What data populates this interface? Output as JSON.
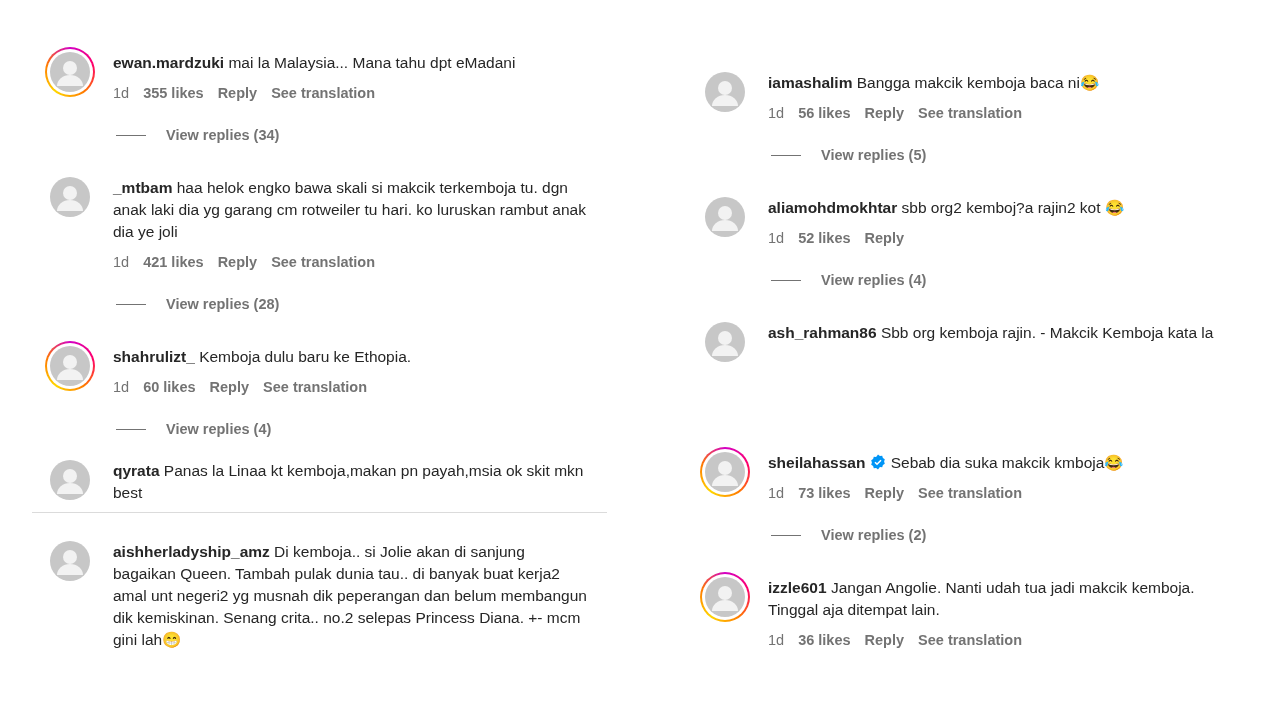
{
  "columns": [
    {
      "sections": [
        {
          "bottom_rule": false,
          "comments": [
            {
              "username": "ewan.mardzuki",
              "verified": false,
              "story_ring": true,
              "text": "mai la Malaysia... Mana tahu dpt eMadani",
              "time": "1d",
              "likes": "355 likes",
              "reply": "Reply",
              "translation": "See translation",
              "view_replies": "View replies (34)"
            },
            {
              "username": "_mtbam",
              "verified": false,
              "story_ring": false,
              "text": "haa helok engko bawa skali si makcik terkemboja tu. dgn anak laki dia yg garang cm rotweiler tu hari. ko luruskan rambut anak dia ye joli",
              "time": "1d",
              "likes": "421 likes",
              "reply": "Reply",
              "translation": "See translation",
              "view_replies": "View replies (28)"
            },
            {
              "username": "shahrulizt_",
              "verified": false,
              "story_ring": true,
              "text": "Kemboja dulu baru ke Ethopia.",
              "time": "1d",
              "likes": "60 likes",
              "reply": "Reply",
              "translation": "See translation",
              "view_replies": "View replies (4)"
            }
          ]
        },
        {
          "bottom_rule": true,
          "comments": [
            {
              "username": "qyrata",
              "verified": false,
              "story_ring": false,
              "text": "Panas la Linaa kt kemboja,makan pn payah,msia ok skit mkn best"
            }
          ]
        },
        {
          "bottom_rule": false,
          "comments": [
            {
              "username": "aishherladyship_amz",
              "verified": false,
              "story_ring": false,
              "text": "Di kemboja.. si Jolie akan di sanjung bagaikan Queen. Tambah pulak dunia tau.. di banyak buat kerja2 amal unt negeri2 yg musnah dik peperangan dan belum membangun dik kemiskinan. Senang crita.. no.2 selepas Princess Diana. +- mcm gini lah😁"
            }
          ]
        }
      ]
    },
    {
      "sections": [
        {
          "bottom_rule": false,
          "comments": [
            {
              "username": "iamashalim",
              "verified": false,
              "story_ring": false,
              "text": "Bangga makcik kemboja baca ni😂",
              "time": "1d",
              "likes": "56 likes",
              "reply": "Reply",
              "translation": "See translation",
              "view_replies": "View replies (5)"
            },
            {
              "username": "aliamohdmokhtar",
              "verified": false,
              "story_ring": false,
              "text": "sbb org2 kemboj?a rajin2 kot 😂",
              "time": "1d",
              "likes": "52 likes",
              "reply": "Reply",
              "view_replies": "View replies (4)"
            },
            {
              "username": "ash_rahman86",
              "verified": false,
              "story_ring": false,
              "text": "Sbb org kemboja rajin. - Makcik Kemboja kata la"
            }
          ]
        },
        {
          "bottom_rule": false,
          "comments": [
            {
              "username": "sheilahassan",
              "verified": true,
              "story_ring": true,
              "text": "Sebab dia suka makcik kmboja😂",
              "time": "1d",
              "likes": "73 likes",
              "reply": "Reply",
              "translation": "See translation",
              "view_replies": "View replies (2)"
            },
            {
              "username": "izzle601",
              "verified": false,
              "story_ring": true,
              "text": "Jangan Angolie. Nanti udah tua jadi makcik kemboja. Tinggal aja ditempat lain.",
              "time": "1d",
              "likes": "36 likes",
              "reply": "Reply",
              "translation": "See translation"
            }
          ]
        }
      ]
    }
  ]
}
